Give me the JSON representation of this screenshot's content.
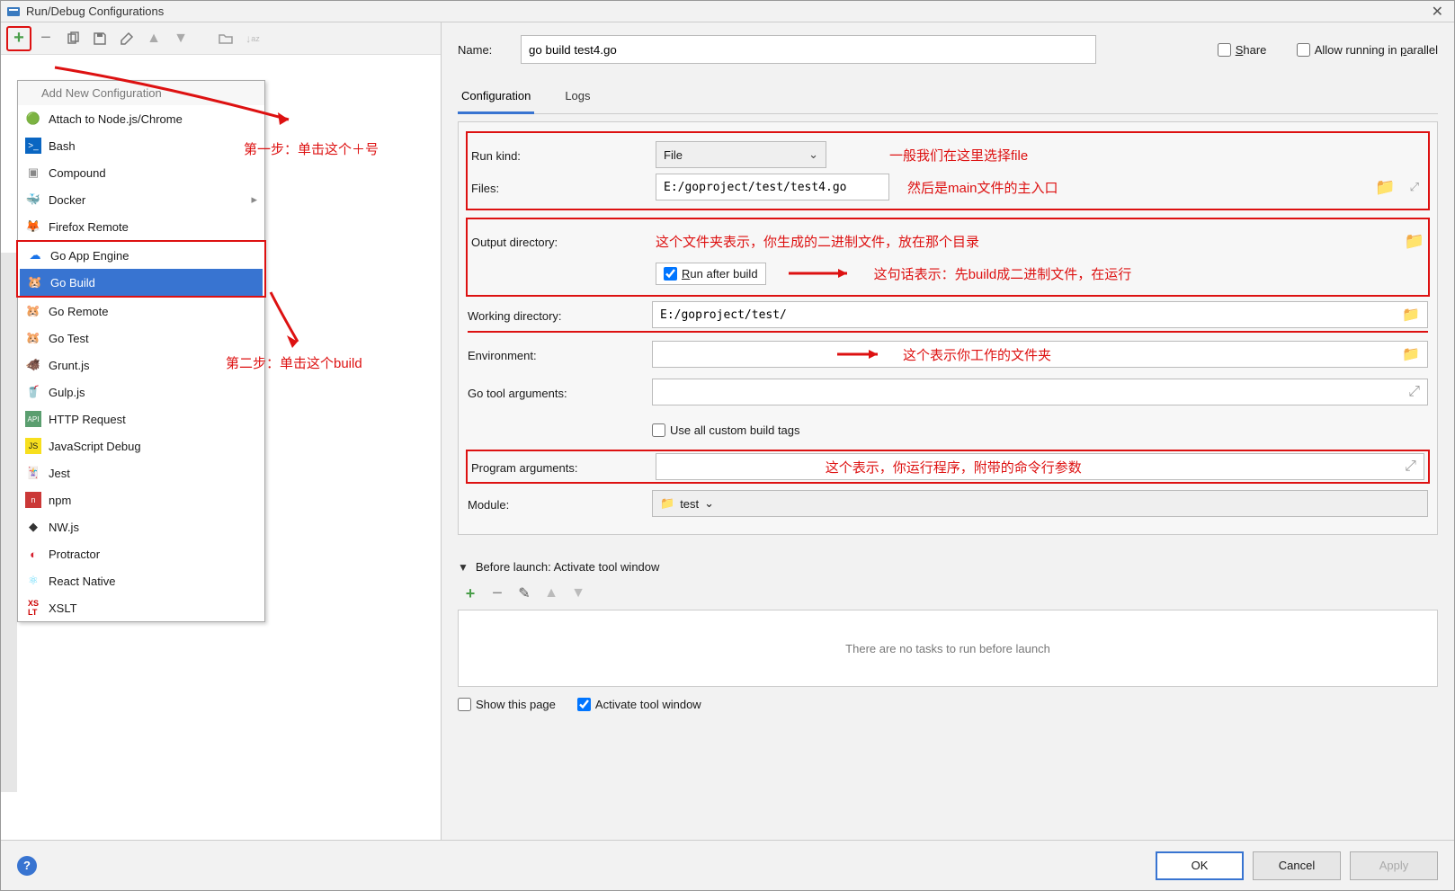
{
  "window": {
    "title": "Run/Debug Configurations"
  },
  "toolbar": {},
  "popup": {
    "title": "Add New Configuration",
    "items": [
      {
        "icon": "node",
        "label": "Attach to Node.js/Chrome"
      },
      {
        "icon": "bash",
        "label": "Bash"
      },
      {
        "icon": "compound",
        "label": "Compound"
      },
      {
        "icon": "docker",
        "label": "Docker",
        "sub": true
      },
      {
        "icon": "firefox",
        "label": "Firefox Remote"
      },
      {
        "icon": "goapp",
        "label": "Go App Engine"
      },
      {
        "icon": "go",
        "label": "Go Build",
        "selected": true
      },
      {
        "icon": "goremote",
        "label": "Go Remote"
      },
      {
        "icon": "gotest",
        "label": "Go Test"
      },
      {
        "icon": "grunt",
        "label": "Grunt.js"
      },
      {
        "icon": "gulp",
        "label": "Gulp.js"
      },
      {
        "icon": "http",
        "label": "HTTP Request"
      },
      {
        "icon": "jsdebug",
        "label": "JavaScript Debug"
      },
      {
        "icon": "jest",
        "label": "Jest"
      },
      {
        "icon": "npm",
        "label": "npm"
      },
      {
        "icon": "nwjs",
        "label": "NW.js"
      },
      {
        "icon": "protractor",
        "label": "Protractor"
      },
      {
        "icon": "react",
        "label": "React Native"
      },
      {
        "icon": "xslt",
        "label": "XSLT"
      }
    ]
  },
  "ann": {
    "step1": "第一步：单击这个＋号",
    "step2": "第二步：单击这个build",
    "runkind": "一般我们在这里选择file",
    "files": "然后是main文件的主入口",
    "outdir": "这个文件夹表示，你生成的二进制文件，放在那个目录",
    "runafter": "这句话表示：先build成二进制文件，在运行",
    "workdir": "这个表示你工作的文件夹",
    "progargs": "这个表示，你运行程序，附带的命令行参数"
  },
  "form": {
    "name_label": "Name:",
    "name_value": "go build test4.go",
    "share": "Share",
    "allow_parallel": "Allow running in parallel",
    "tab_config": "Configuration",
    "tab_logs": "Logs",
    "runkind_label": "Run kind:",
    "runkind_value": "File",
    "files_label": "Files:",
    "files_value": "E:/goproject/test/test4.go",
    "outdir_label": "Output directory:",
    "runafter_label": "Run after build",
    "workdir_label": "Working directory:",
    "workdir_value": "E:/goproject/test/",
    "env_label": "Environment:",
    "gotool_label": "Go tool arguments:",
    "usetags_label": "Use all custom build tags",
    "progargs_label": "Program arguments:",
    "module_label": "Module:",
    "module_value": "test"
  },
  "before_launch": {
    "title": "Before launch: Activate tool window",
    "empty": "There are no tasks to run before launch",
    "show_page": "Show this page",
    "activate": "Activate tool window"
  },
  "buttons": {
    "ok": "OK",
    "cancel": "Cancel",
    "apply": "Apply"
  }
}
